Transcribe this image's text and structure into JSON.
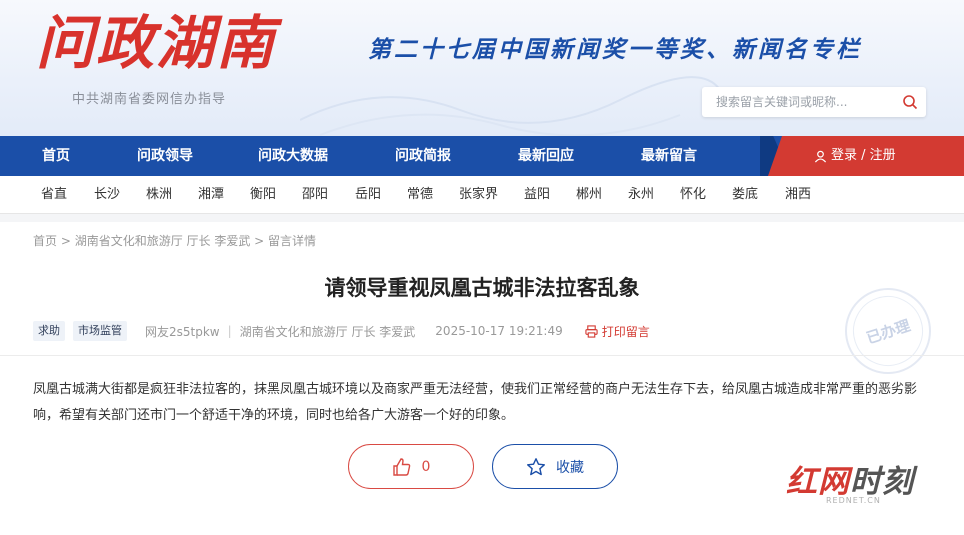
{
  "header": {
    "logo_text": "问政湖南",
    "logo_subtitle": "中共湖南省委网信办指导",
    "slogan": "第二十七届中国新闻奖一等奖、新闻名专栏",
    "search_placeholder": "搜索留言关键词或昵称..."
  },
  "nav": {
    "items": [
      "首页",
      "问政领导",
      "问政大数据",
      "问政简报",
      "最新回应",
      "最新留言"
    ],
    "login_label": "登录 / 注册"
  },
  "regions": [
    "省直",
    "长沙",
    "株洲",
    "湘潭",
    "衡阳",
    "邵阳",
    "岳阳",
    "常德",
    "张家界",
    "益阳",
    "郴州",
    "永州",
    "怀化",
    "娄底",
    "湘西"
  ],
  "breadcrumb": {
    "home": "首页",
    "sep": " > ",
    "target": "湖南省文化和旅游厅 厅长 李爱武",
    "current": "留言详情"
  },
  "post": {
    "title": "请领导重视凤凰古城非法拉客乱象",
    "tags": [
      "求助",
      "市场监管"
    ],
    "author": "网友2s5tpkw",
    "recipient": "湖南省文化和旅游厅 厅长 李爱武",
    "datetime": "2025-10-17 19:21:49",
    "print_label": "打印留言",
    "status_stamp": "已办理",
    "content": "凤凰古城满大街都是疯狂非法拉客的，抹黑凤凰古城环境以及商家严重无法经营，使我们正常经营的商户无法生存下去，给凤凰古城造成非常严重的恶劣影响，希望有关部门还市门一个舒适干净的环境，同时也给各广大游客一个好的印象。"
  },
  "actions": {
    "like_count": "0",
    "favorite_label": "收藏"
  },
  "watermark": {
    "brand_red": "红网",
    "brand_gray": "时刻",
    "domain": "REDNET.CN"
  },
  "colors": {
    "nav_blue": "#1b4fa8",
    "accent_red": "#d33a32"
  }
}
